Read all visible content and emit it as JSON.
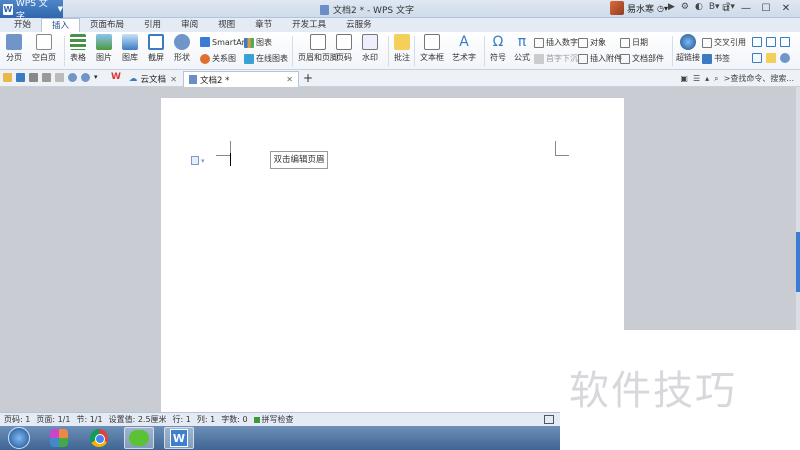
{
  "titlebar": {
    "app_name": "WPS 文字",
    "document_title": "文档2 * - WPS 文字",
    "user_name": "易水寒"
  },
  "menu": {
    "tabs": [
      "开始",
      "插入",
      "页面布局",
      "引用",
      "审阅",
      "视图",
      "章节",
      "开发工具",
      "云服务"
    ],
    "active": "插入"
  },
  "ribbon": {
    "page_break": "分页",
    "blank_page": "空白页",
    "table": "表格",
    "picture": "图片",
    "gallery": "图库",
    "screenshot": "截屏",
    "shape": "形状",
    "smartart": "SmartArt",
    "chart": "图表",
    "relation_chart": "关系图",
    "online_chart": "在线图表",
    "header_footer": "页眉和页脚",
    "page_number": "页码",
    "watermark": "水印",
    "comment": "批注",
    "textbox": "文本框",
    "wordart": "艺术字",
    "symbol": "符号",
    "formula": "公式",
    "insert_number": "插入数字",
    "first_letter": "首字下沉",
    "object": "对象",
    "insert_attachment": "插入附件",
    "date": "日期",
    "doc_parts": "文档部件",
    "hyperlink": "超链接",
    "cross_ref": "交叉引用",
    "bookmark": "书签"
  },
  "tabbar": {
    "cloud_doc": "云文档",
    "active_doc": "文档2 *",
    "search_placeholder": ">查找命令、搜索..."
  },
  "document": {
    "header_hint": "双击编辑页眉"
  },
  "statusbar": {
    "page_number": "页码: 1",
    "pages": "页面: 1/1",
    "section": "节: 1/1",
    "setting": "设置值: 2.5厘米",
    "line": "行: 1",
    "column": "列: 1",
    "word_count": "字数: 0",
    "spellcheck": "拼写检查"
  },
  "watermark_text": "软件技巧",
  "colors": {
    "accent": "#2f66ad",
    "workspace": "#c9ccd3",
    "taskbar": "#3f6593"
  }
}
